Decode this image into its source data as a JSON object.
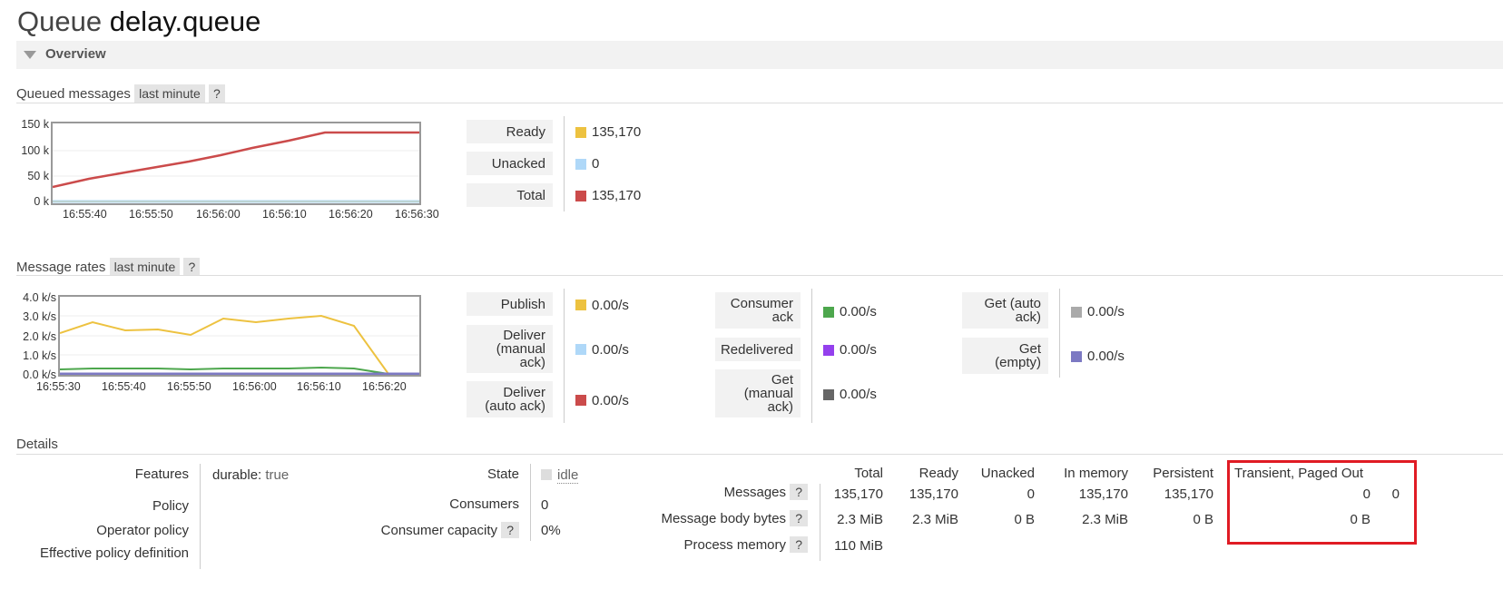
{
  "header": {
    "prefix": "Queue",
    "queue_name": "delay.queue"
  },
  "overview": {
    "label": "Overview"
  },
  "queued": {
    "title": "Queued messages",
    "range": "last minute",
    "help": "?",
    "y_ticks": [
      "150 k",
      "100 k",
      "50 k",
      "0 k"
    ],
    "x_ticks": [
      "16:55:40",
      "16:55:50",
      "16:56:00",
      "16:56:10",
      "16:56:20",
      "16:56:30"
    ],
    "legend": [
      {
        "label": "Ready",
        "color": "#edc240",
        "value": "135,170"
      },
      {
        "label": "Unacked",
        "color": "#afd8f8",
        "value": "0"
      },
      {
        "label": "Total",
        "color": "#cb4b4b",
        "value": "135,170"
      }
    ]
  },
  "rates": {
    "title": "Message rates",
    "range": "last minute",
    "help": "?",
    "y_ticks": [
      "4.0 k/s",
      "3.0 k/s",
      "2.0 k/s",
      "1.0 k/s",
      "0.0 k/s"
    ],
    "x_ticks": [
      "16:55:30",
      "16:55:40",
      "16:55:50",
      "16:56:00",
      "16:56:10",
      "16:56:20"
    ],
    "col1": [
      {
        "label": "Publish",
        "color": "#edc240",
        "value": "0.00/s"
      },
      {
        "label": "Deliver (manual ack)",
        "color": "#afd8f8",
        "value": "0.00/s"
      },
      {
        "label": "Deliver (auto ack)",
        "color": "#cb4b4b",
        "value": "0.00/s"
      }
    ],
    "col2": [
      {
        "label": "Consumer ack",
        "color": "#4da74d",
        "value": "0.00/s"
      },
      {
        "label": "Redelivered",
        "color": "#9440ed",
        "value": "0.00/s"
      },
      {
        "label": "Get (manual ack)",
        "color": "#666666",
        "value": "0.00/s"
      }
    ],
    "col3": [
      {
        "label": "Get (auto ack)",
        "color": "#aaaaaa",
        "value": "0.00/s"
      },
      {
        "label": "Get (empty)",
        "color": "#7c79c3",
        "value": "0.00/s"
      }
    ]
  },
  "details": {
    "title": "Details",
    "features_label": "Features",
    "features_key": "durable:",
    "features_value": "true",
    "policy_label": "Policy",
    "operator_policy_label": "Operator policy",
    "effective_policy_label": "Effective policy definition",
    "state_label": "State",
    "state_value": "idle",
    "consumers_label": "Consumers",
    "consumers_value": "0",
    "capacity_label": "Consumer capacity",
    "capacity_help": "?",
    "capacity_value": "0%",
    "table": {
      "headers": [
        "Total",
        "Ready",
        "Unacked",
        "In memory",
        "Persistent",
        "Transient, Paged Out"
      ],
      "rows": [
        {
          "label": "Messages",
          "help": "?",
          "cells": [
            "135,170",
            "135,170",
            "0",
            "135,170",
            "135,170",
            "0",
            "0"
          ]
        },
        {
          "label": "Message body bytes",
          "help": "?",
          "cells": [
            "2.3 MiB",
            "2.3 MiB",
            "0 B",
            "2.3 MiB",
            "0 B",
            "0 B"
          ]
        },
        {
          "label": "Process memory",
          "help": "?",
          "cells": [
            "110 MiB"
          ]
        }
      ]
    }
  }
}
